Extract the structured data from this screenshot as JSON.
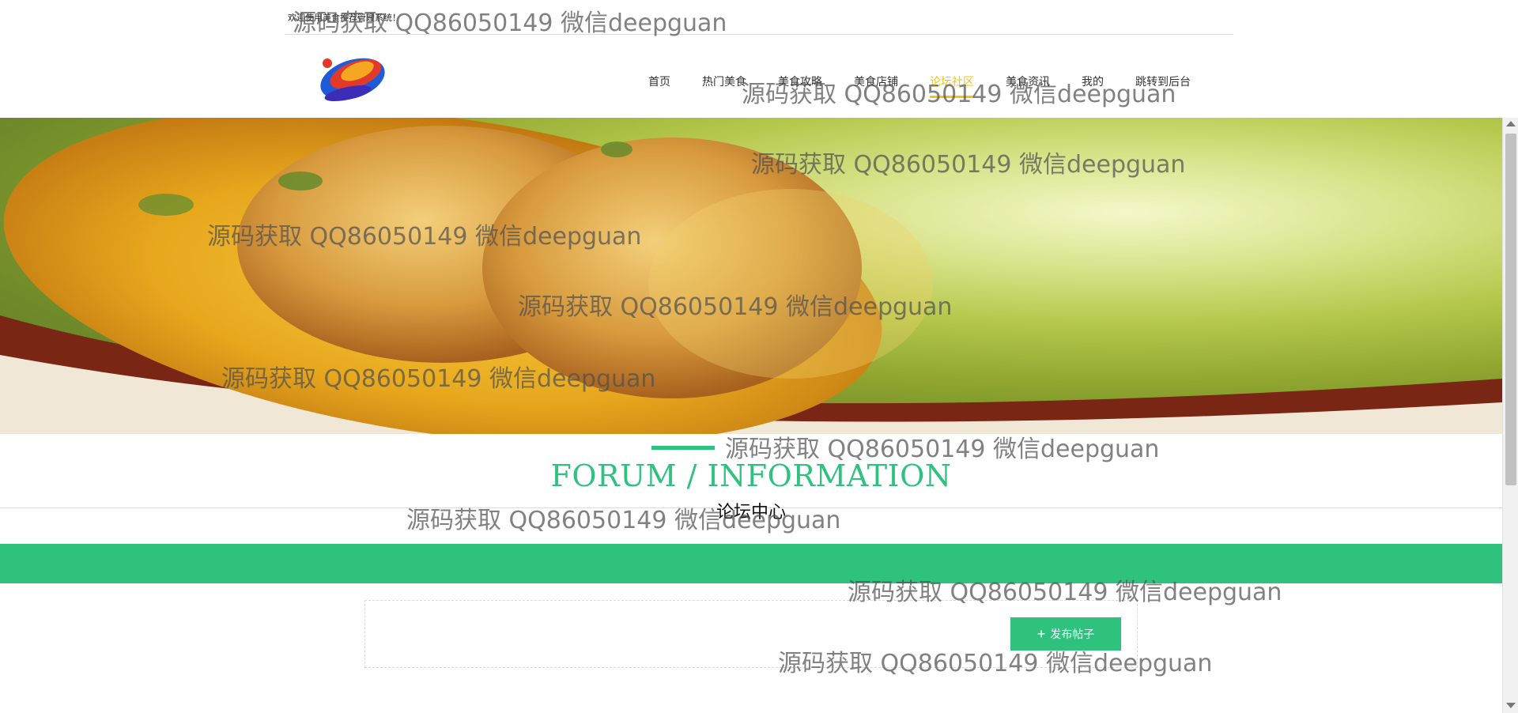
{
  "topbar": {
    "welcome": "欢迎使用美食推荐管理系统！"
  },
  "nav": {
    "items": [
      {
        "label": "首页"
      },
      {
        "label": "热门美食"
      },
      {
        "label": "美食攻略"
      },
      {
        "label": "美食店铺"
      },
      {
        "label": "论坛社区"
      },
      {
        "label": "美食资讯"
      },
      {
        "label": "我的"
      },
      {
        "label": "跳转到后台"
      }
    ]
  },
  "section": {
    "title_en": "FORUM / INFORMATION",
    "title_cn": "论坛中心"
  },
  "actions": {
    "post_label": "发布帖子"
  },
  "watermark": "源码获取 QQ86050149 微信deepguan",
  "colors": {
    "accent": "#2ec27e",
    "active_nav": "#f1c40f"
  },
  "icons": {
    "post": "plus-icon",
    "logo": "brand-logo"
  }
}
